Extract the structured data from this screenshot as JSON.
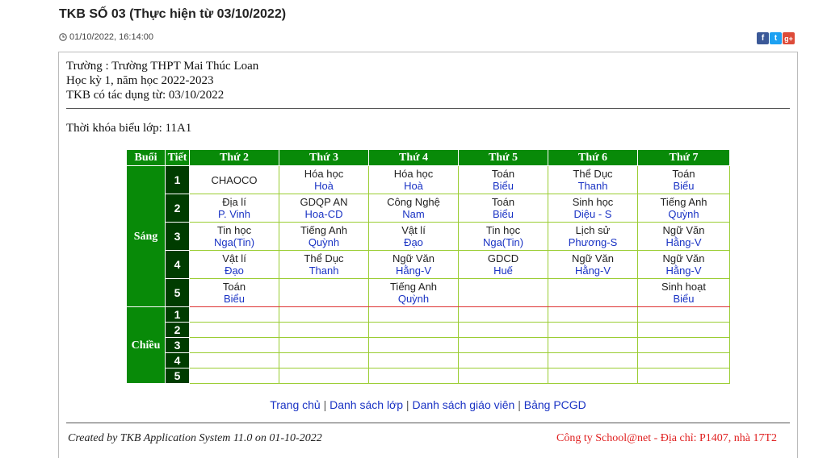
{
  "page": {
    "title": "TKB SỐ 03 (Thực hiện từ 03/10/2022)",
    "timestamp": "01/10/2022, 16:14:00"
  },
  "share": {
    "facebook": "f",
    "twitter": "t",
    "googleplus": "g+"
  },
  "school": {
    "name_line": "Trường : Trường THPT Mai Thúc Loan",
    "term_line": "Học kỳ 1, năm học 2022-2023",
    "effective_line": "TKB có tác dụng từ: 03/10/2022"
  },
  "class_title": "Thời khóa biểu lớp: 11A1",
  "timetable": {
    "headers": [
      "Buổi",
      "Tiết",
      "Thứ 2",
      "Thứ 3",
      "Thứ 4",
      "Thứ 5",
      "Thứ 6",
      "Thứ 7"
    ],
    "morning_label": "Sáng",
    "afternoon_label": "Chiều",
    "morning": [
      {
        "period": "1",
        "cells": [
          {
            "subject": "CHAOCO",
            "teacher": ""
          },
          {
            "subject": "Hóa học",
            "teacher": "Hoà"
          },
          {
            "subject": "Hóa học",
            "teacher": "Hoà"
          },
          {
            "subject": "Toán",
            "teacher": "Biểu"
          },
          {
            "subject": "Thể Dục",
            "teacher": "Thanh"
          },
          {
            "subject": "Toán",
            "teacher": "Biểu"
          }
        ]
      },
      {
        "period": "2",
        "cells": [
          {
            "subject": "Địa lí",
            "teacher": "P. Vinh"
          },
          {
            "subject": "GDQP AN",
            "teacher": "Hoa-CD"
          },
          {
            "subject": "Công Nghệ",
            "teacher": "Nam"
          },
          {
            "subject": "Toán",
            "teacher": "Biểu"
          },
          {
            "subject": "Sinh học",
            "teacher": "Diệu - S"
          },
          {
            "subject": "Tiếng Anh",
            "teacher": "Quỳnh"
          }
        ]
      },
      {
        "period": "3",
        "cells": [
          {
            "subject": "Tin học",
            "teacher": "Nga(Tin)"
          },
          {
            "subject": "Tiếng Anh",
            "teacher": "Quỳnh"
          },
          {
            "subject": "Vật lí",
            "teacher": "Đạo"
          },
          {
            "subject": "Tin học",
            "teacher": "Nga(Tin)"
          },
          {
            "subject": "Lịch sử",
            "teacher": "Phương-S"
          },
          {
            "subject": "Ngữ Văn",
            "teacher": "Hằng-V"
          }
        ]
      },
      {
        "period": "4",
        "cells": [
          {
            "subject": "Vật lí",
            "teacher": "Đạo"
          },
          {
            "subject": "Thể Dục",
            "teacher": "Thanh"
          },
          {
            "subject": "Ngữ Văn",
            "teacher": "Hằng-V"
          },
          {
            "subject": "GDCD",
            "teacher": "Huế"
          },
          {
            "subject": "Ngữ Văn",
            "teacher": "Hằng-V"
          },
          {
            "subject": "Ngữ Văn",
            "teacher": "Hằng-V"
          }
        ]
      },
      {
        "period": "5",
        "cells": [
          {
            "subject": "Toán",
            "teacher": "Biểu"
          },
          {
            "subject": "",
            "teacher": ""
          },
          {
            "subject": "Tiếng Anh",
            "teacher": "Quỳnh"
          },
          {
            "subject": "",
            "teacher": ""
          },
          {
            "subject": "",
            "teacher": ""
          },
          {
            "subject": "Sinh hoạt",
            "teacher": "Biểu"
          }
        ]
      }
    ],
    "afternoon_periods": [
      "1",
      "2",
      "3",
      "4",
      "5"
    ]
  },
  "nav": {
    "home": "Trang chủ",
    "classes": "Danh sách lớp",
    "teachers": "Danh sách giáo viên",
    "assignments": "Bảng PCGD",
    "separator": "|"
  },
  "footer": {
    "left": "Created by TKB Application System 11.0 on 01-10-2022",
    "right": "Công ty School@net - Địa chỉ: P1407, nhà 17T2"
  }
}
